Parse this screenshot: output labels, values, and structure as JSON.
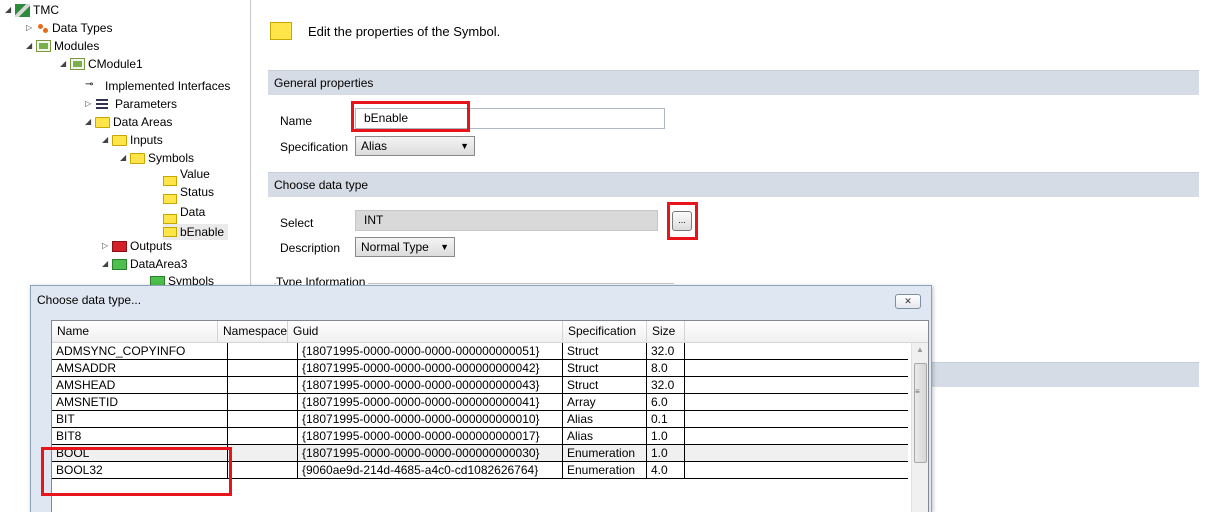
{
  "tree": {
    "items": [
      {
        "label": "TMC"
      },
      {
        "label": "Data Types"
      },
      {
        "label": "Modules"
      },
      {
        "label": "CModule1"
      },
      {
        "label": "Implemented Interfaces"
      },
      {
        "label": "Parameters"
      },
      {
        "label": "Data Areas"
      },
      {
        "label": "Inputs"
      },
      {
        "label": "Symbols"
      },
      {
        "label": "Value"
      },
      {
        "label": "Status"
      },
      {
        "label": "Data"
      },
      {
        "label": "bEnable"
      },
      {
        "label": "Outputs"
      },
      {
        "label": "DataArea3"
      },
      {
        "label": "Symbols"
      }
    ]
  },
  "editor": {
    "heading": "Edit the properties of the Symbol.",
    "general_properties": "General properties",
    "name_label": "Name",
    "name_value": "bEnable",
    "specification_label": "Specification",
    "specification_value": "Alias",
    "choose_data_type": "Choose data type",
    "select_label": "Select",
    "select_value": "INT",
    "browse_button": "...",
    "description_label": "Description",
    "description_value": "Normal Type",
    "type_information": "Type Information"
  },
  "dialog": {
    "title": "Choose data type...",
    "columns": [
      "Name",
      "Namespace",
      "Guid",
      "Specification",
      "Size"
    ],
    "rows": [
      [
        "ADMSYNC_COPYINFO",
        "",
        "{18071995-0000-0000-0000-000000000051}",
        "Struct",
        "32.0"
      ],
      [
        "AMSADDR",
        "",
        "{18071995-0000-0000-0000-000000000042}",
        "Struct",
        "8.0"
      ],
      [
        "AMSHEAD",
        "",
        "{18071995-0000-0000-0000-000000000043}",
        "Struct",
        "32.0"
      ],
      [
        "AMSNETID",
        "",
        "{18071995-0000-0000-0000-000000000041}",
        "Array",
        "6.0"
      ],
      [
        "BIT",
        "",
        "{18071995-0000-0000-0000-000000000010}",
        "Alias",
        "0.1"
      ],
      [
        "BIT8",
        "",
        "{18071995-0000-0000-0000-000000000017}",
        "Alias",
        "1.0"
      ],
      [
        "BOOL",
        "",
        "{18071995-0000-0000-0000-000000000030}",
        "Enumeration",
        "1.0"
      ],
      [
        "BOOL32",
        "",
        "{9060ae9d-214d-4685-a4c0-cd1082626764}",
        "Enumeration",
        "4.0"
      ]
    ],
    "selected_row": "BOOL"
  }
}
